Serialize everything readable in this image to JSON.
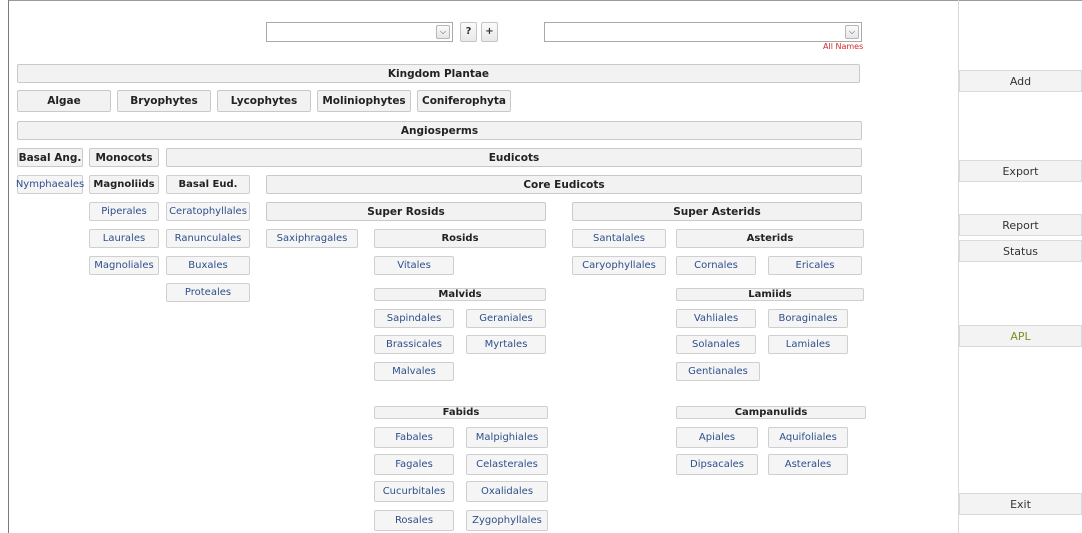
{
  "top_controls": {
    "help_label": "?",
    "add_label": "+",
    "all_names_label": "All Names"
  },
  "kingdom": "Kingdom Plantae",
  "groups": [
    "Algae",
    "Bryophytes",
    "Lycophytes",
    "Moliniophytes",
    "Coniferophyta"
  ],
  "angiosperms": "Angiosperms",
  "basal_ang": "Basal Ang.",
  "monocots": "Monocots",
  "eudicots": "Eudicots",
  "nymphaeales": "Nymphaeales",
  "magnoliids": {
    "title": "Magnoliids",
    "orders": [
      "Piperales",
      "Laurales",
      "Magnoliales"
    ]
  },
  "basal_eud": {
    "title": "Basal Eud.",
    "orders": [
      "Ceratophyllales",
      "Ranunculales",
      "Buxales",
      "Proteales"
    ]
  },
  "core_eudicots": "Core Eudicots",
  "super_rosids": "Super Rosids",
  "saxifragales": "Saxiphragales",
  "rosids": "Rosids",
  "vitales": "Vitales",
  "malvids": {
    "title": "Malvids",
    "orders": [
      "Sapindales",
      "Geraniales",
      "Brassicales",
      "Myrtales",
      "Malvales"
    ]
  },
  "fabids": {
    "title": "Fabids",
    "orders": [
      "Fabales",
      "Malpighiales",
      "Fagales",
      "Celasterales",
      "Cucurbitales",
      "Oxalidales",
      "Rosales",
      "Zygophyllales"
    ]
  },
  "super_asterids": "Super Asterids",
  "santalales": "Santalales",
  "caryophyllales": "Caryophyllales",
  "asterids": "Asterids",
  "cornales": "Cornales",
  "ericales": "Ericales",
  "lamiids": {
    "title": "Lamiids",
    "orders": [
      "Vahliales",
      "Boraginales",
      "Solanales",
      "Lamiales",
      "Gentianales"
    ]
  },
  "campanulids": {
    "title": "Campanulids",
    "orders": [
      "Apiales",
      "Aquifoliales",
      "Dipsacales",
      "Asterales"
    ]
  },
  "sidebar": {
    "add": "Add",
    "export": "Export",
    "report": "Report",
    "status": "Status",
    "apl": "APL",
    "exit": "Exit"
  },
  "icons": {
    "dropdown": "chevron-down-icon"
  }
}
